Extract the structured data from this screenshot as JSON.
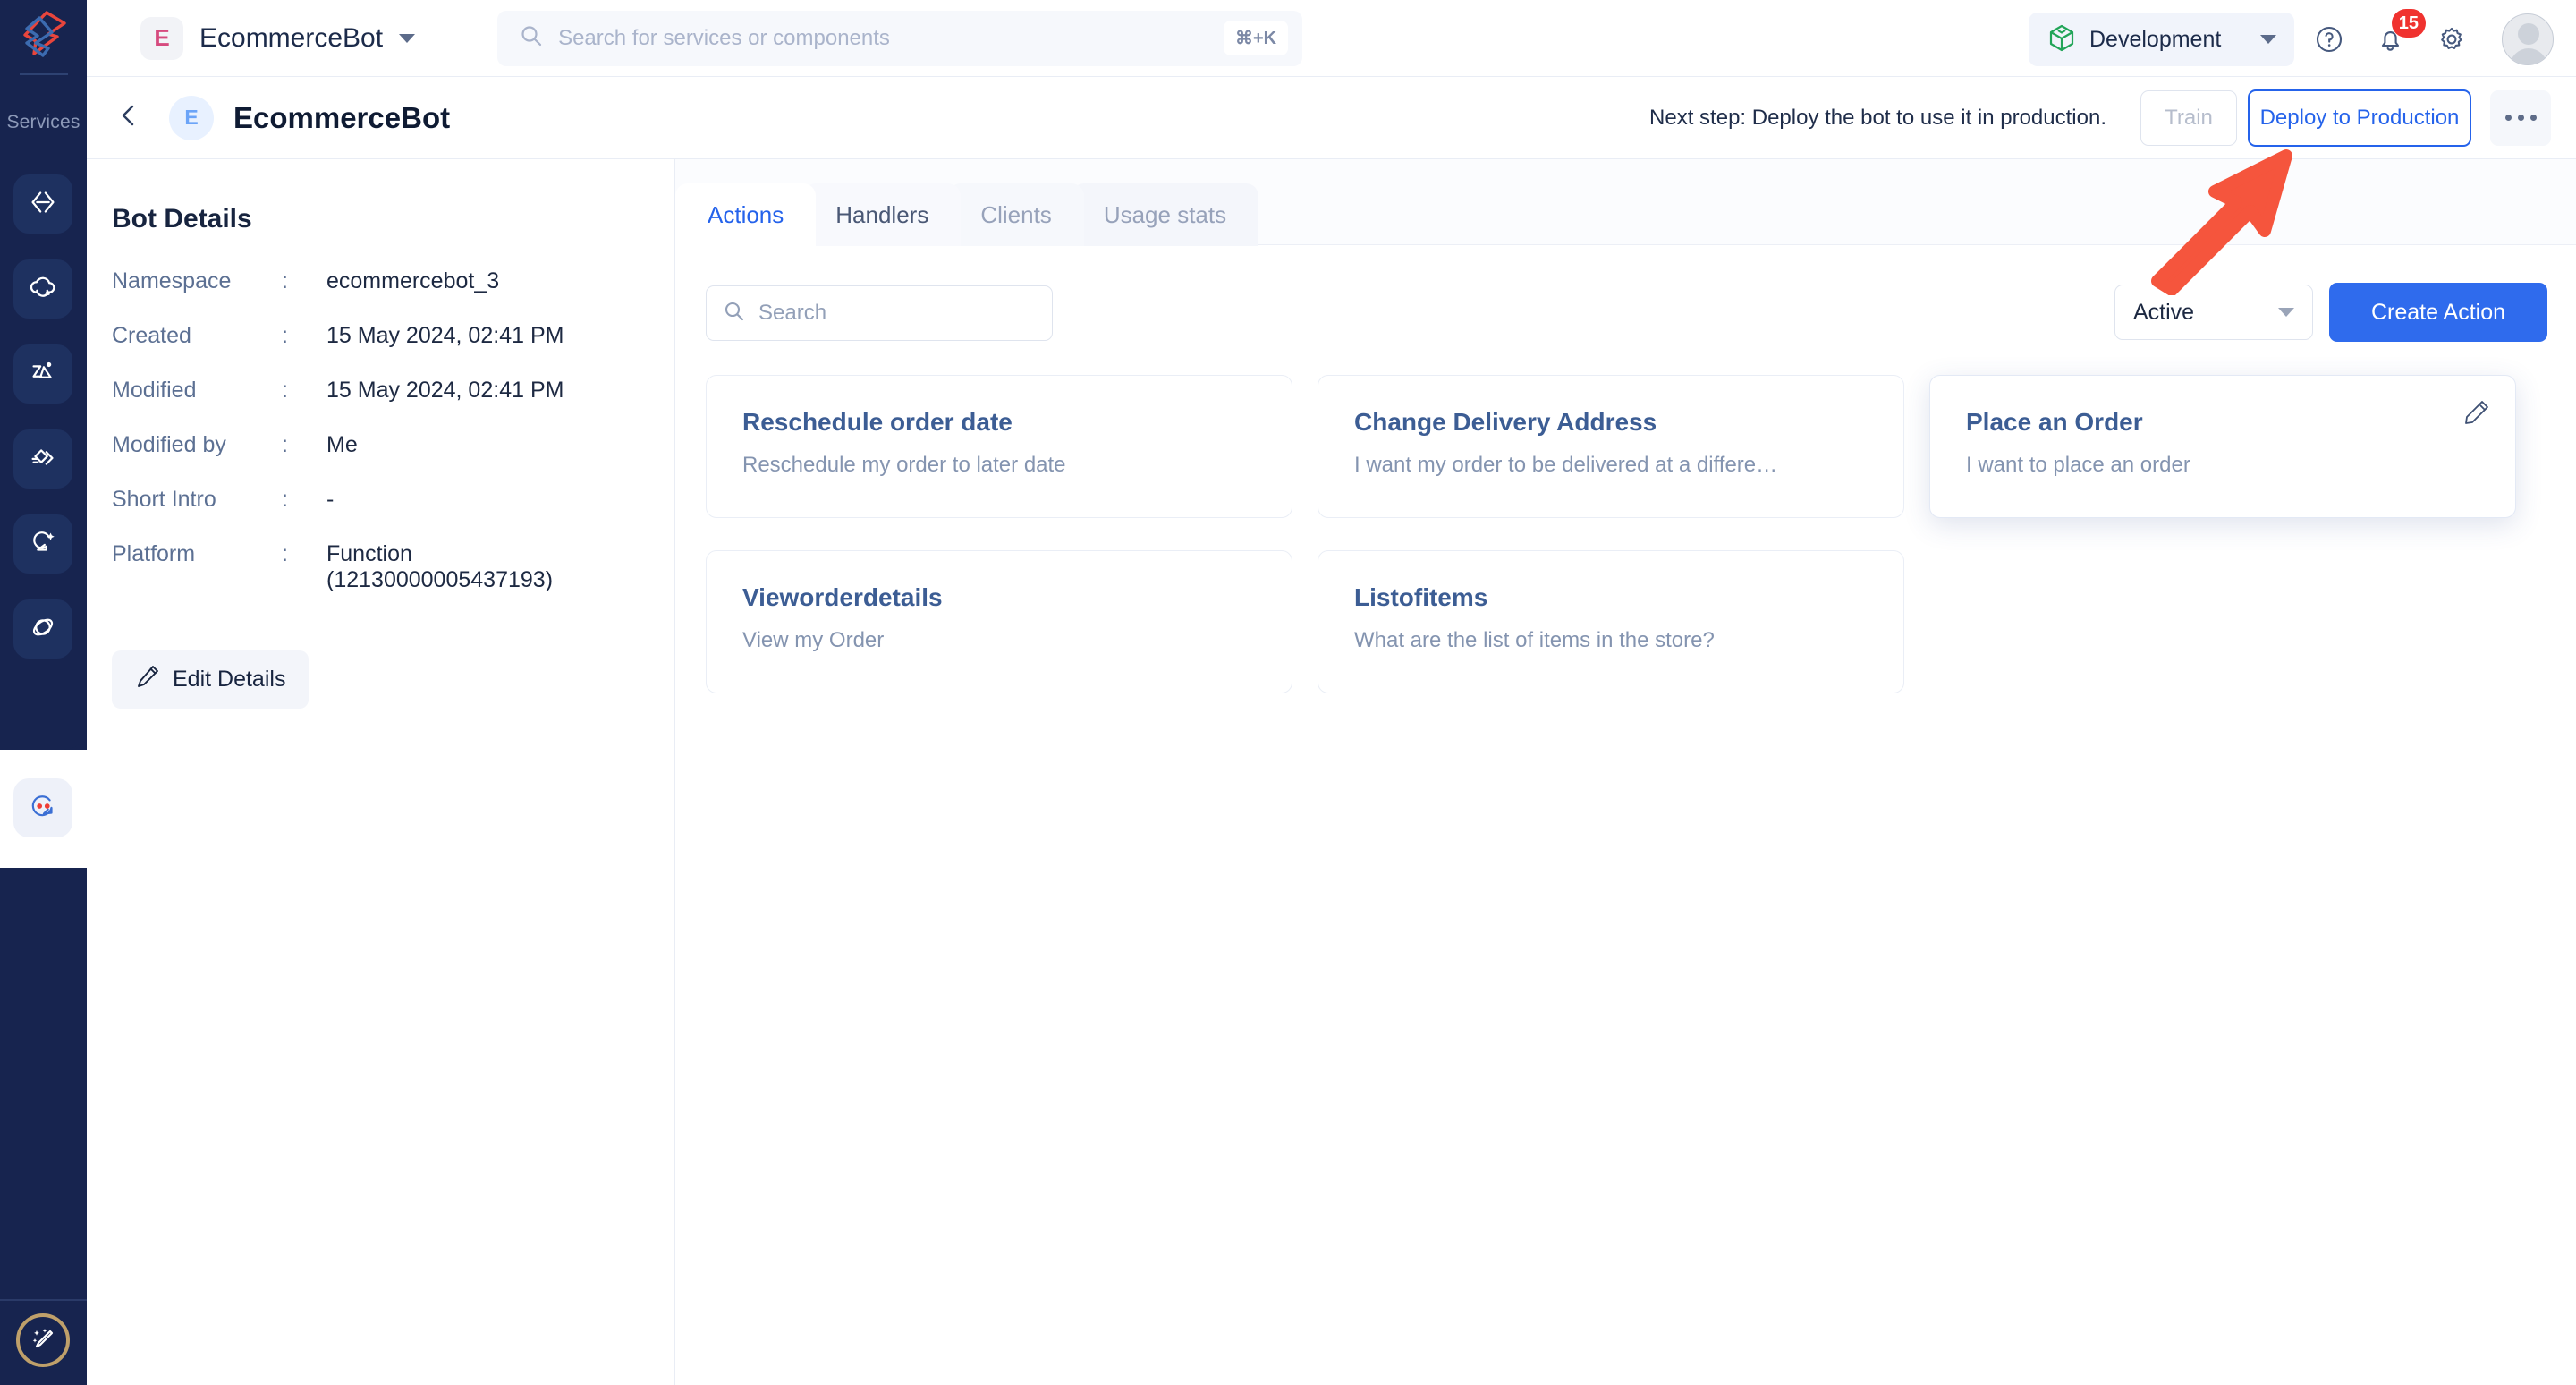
{
  "rail": {
    "logo_name": "brand-logo",
    "services_label": "Services",
    "items": [
      {
        "name": "sidebar-item-code",
        "icon": "code-brackets-icon"
      },
      {
        "name": "sidebar-item-cloud",
        "icon": "cloud-upload-icon"
      },
      {
        "name": "sidebar-item-integration",
        "icon": "integration-icon"
      },
      {
        "name": "sidebar-item-handshake",
        "icon": "handshake-icon"
      },
      {
        "name": "sidebar-item-insights",
        "icon": "magic-search-icon"
      },
      {
        "name": "sidebar-item-orbit",
        "icon": "orbit-icon"
      },
      {
        "name": "sidebar-item-bots",
        "icon": "bot-chat-icon"
      }
    ],
    "magic_icon": "magic-wand-icon"
  },
  "topbar": {
    "app_badge_letter": "E",
    "app_title": "EcommerceBot",
    "search": {
      "placeholder": "Search for services or components",
      "shortcut": "⌘+K",
      "icon": "search-icon"
    },
    "environment": "Development",
    "env_icon": "cube-icon",
    "help_icon": "help-circle-icon",
    "bell_icon": "bell-icon",
    "notification_count": "15",
    "gear_icon": "gear-icon",
    "avatar_name": "user-avatar"
  },
  "subheader": {
    "back_icon": "chevron-left-icon",
    "bot_badge_letter": "E",
    "bot_name": "EcommerceBot",
    "next_step": "Next step: Deploy the bot to use it in production.",
    "train_label": "Train",
    "deploy_label": "Deploy to Production",
    "more_icon": "ellipsis-icon"
  },
  "details": {
    "title": "Bot Details",
    "rows": [
      {
        "label": "Namespace",
        "value": "ecommercebot_3"
      },
      {
        "label": "Created",
        "value": "15 May 2024, 02:41 PM"
      },
      {
        "label": "Modified",
        "value": "15 May 2024, 02:41 PM"
      },
      {
        "label": "Modified by",
        "value": "Me"
      },
      {
        "label": "Short Intro",
        "value": "-"
      },
      {
        "label": "Platform",
        "value": "Function (12130000005437193)"
      }
    ],
    "colon": ":",
    "edit_label": "Edit Details",
    "edit_icon": "pencil-icon"
  },
  "main": {
    "tabs": [
      {
        "label": "Actions",
        "active": true
      },
      {
        "label": "Handlers",
        "active": false
      },
      {
        "label": "Clients",
        "active": false
      },
      {
        "label": "Usage stats",
        "active": false
      }
    ],
    "search_placeholder": "Search",
    "search_icon": "search-icon",
    "status_filter": "Active",
    "create_label": "Create Action",
    "cards": [
      {
        "title": "Reschedule order date",
        "sub": "Reschedule my order to later date",
        "hovered": false
      },
      {
        "title": "Change Delivery Address",
        "sub": "I want my order to be delivered at a differe…",
        "hovered": false
      },
      {
        "title": "Place an Order",
        "sub": "I want to place an order",
        "hovered": true
      },
      {
        "title": "Vieworderdetails",
        "sub": "View my Order",
        "hovered": false
      },
      {
        "title": "Listofitems",
        "sub": "What are the list of items in the store?",
        "hovered": false
      }
    ],
    "card_edit_icon": "pencil-icon"
  },
  "annotation": {
    "arrow_name": "red-arrow-pointer",
    "arrow_color": "#f5553d"
  },
  "colors": {
    "rail_bg": "#17244f",
    "accent_blue": "#2563eb",
    "primary_button": "#2f6bed",
    "card_title": "#3c5d94",
    "badge_red": "#f0322f",
    "env_green": "#22a558"
  }
}
